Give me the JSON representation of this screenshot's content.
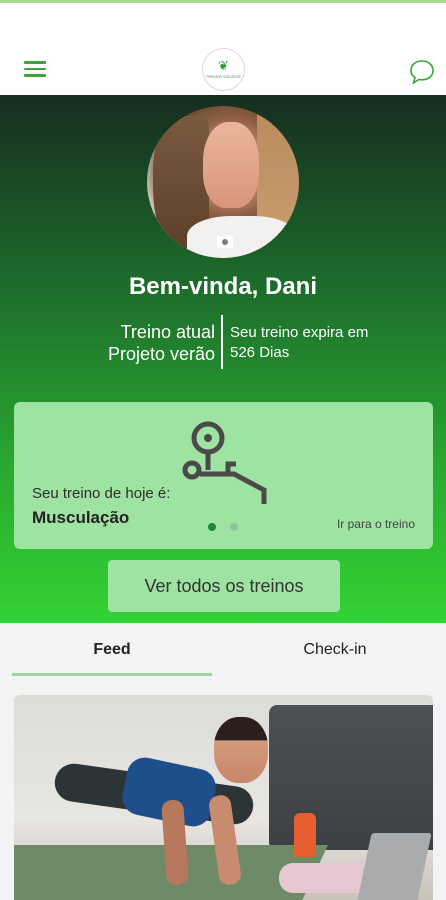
{
  "header": {
    "logo_label": "TREINO DECEDE",
    "menu_icon": "hamburger-menu-icon",
    "chat_icon": "chat-bubble-icon"
  },
  "profile": {
    "welcome": "Bem-vinda, Dani",
    "plan_line1": "Treino atual",
    "plan_line2": "Projeto verão",
    "expire_line1": "Seu treino expira em",
    "expire_line2": "526 Dias"
  },
  "today_card": {
    "label": "Seu treino de hoje é:",
    "value": "Musculação",
    "goto": "Ir para o treino",
    "icon": "barbell-bench-icon",
    "carousel": {
      "count": 2,
      "active": 1
    }
  },
  "all_workouts_button": "Ver todos os treinos",
  "tabs": [
    {
      "label": "Feed",
      "active": true
    },
    {
      "label": "Check-in",
      "active": false
    }
  ],
  "colors": {
    "accent": "#3aa53a",
    "card": "#9fe3a3",
    "hero_top": "#172d1e",
    "hero_bottom": "#33d233"
  }
}
